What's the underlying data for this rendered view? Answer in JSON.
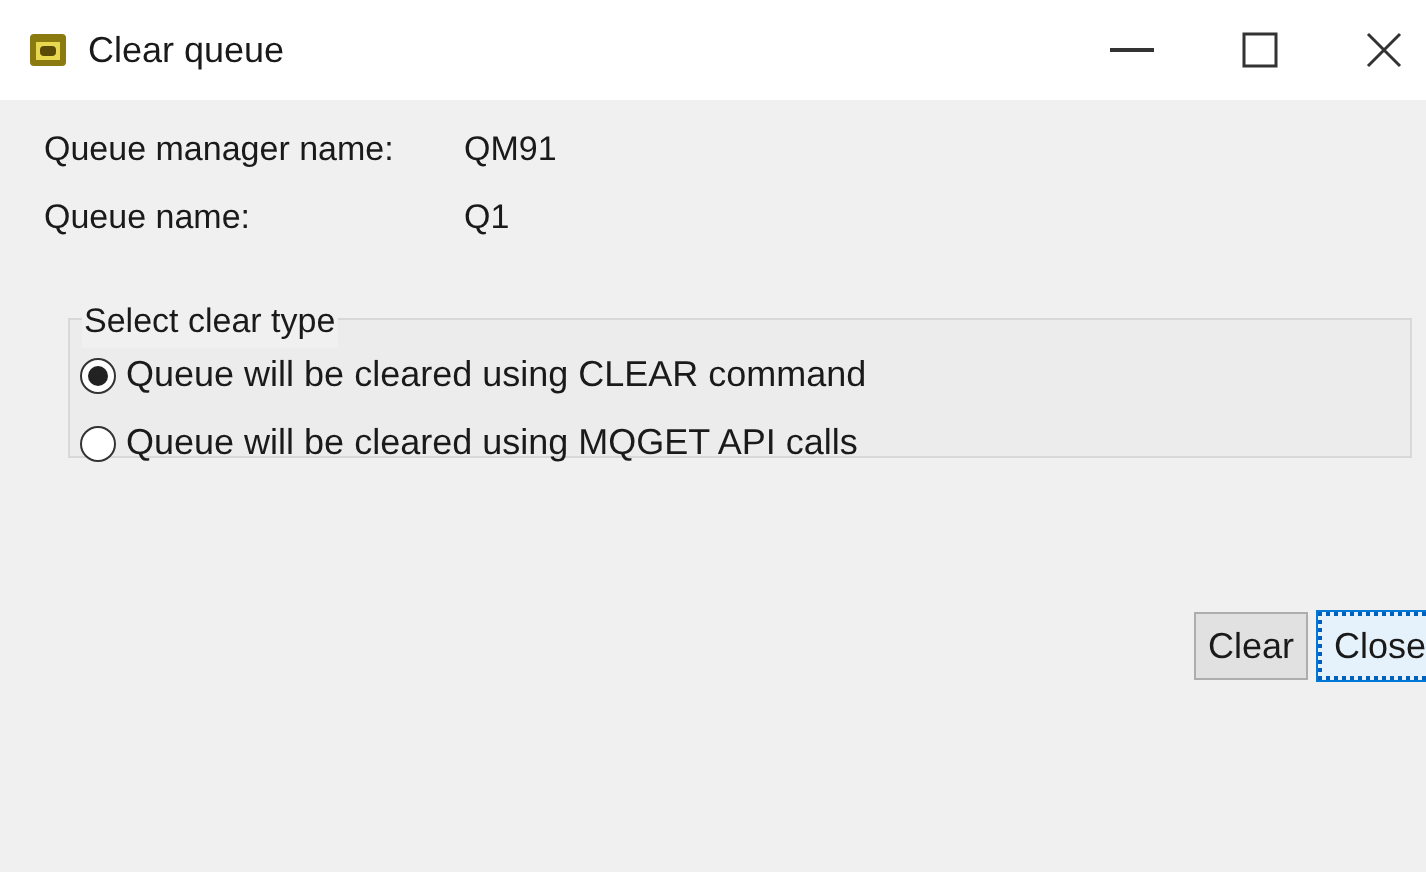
{
  "window": {
    "title": "Clear queue"
  },
  "fields": [
    {
      "label": "Queue manager name:",
      "value": "QM91"
    },
    {
      "label": "Queue name:",
      "value": "Q1"
    }
  ],
  "clear_type": {
    "legend": "Select clear type",
    "options": [
      {
        "label": "Queue will be cleared using CLEAR command",
        "selected": true
      },
      {
        "label": "Queue will be cleared using MQGET API calls",
        "selected": false
      }
    ]
  },
  "buttons": [
    {
      "label": "Clear",
      "focused": false
    },
    {
      "label": "Close",
      "focused": true
    }
  ]
}
